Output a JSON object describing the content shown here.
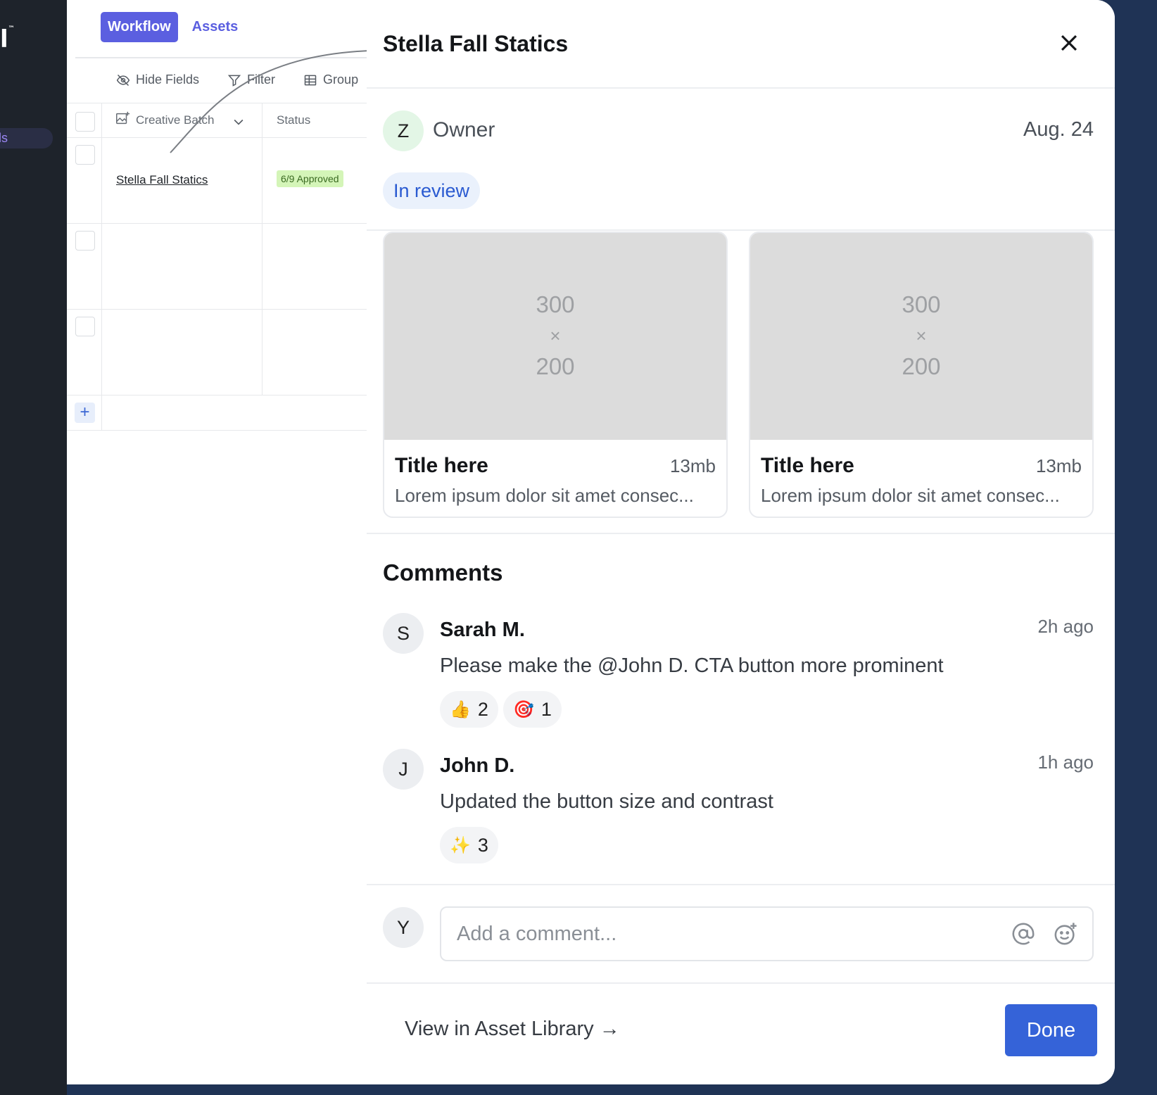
{
  "sidebar": {
    "logo_text": "l",
    "logo_mark": "™",
    "nav_item_label": "ls"
  },
  "tabs": [
    {
      "label": "Workflow",
      "active": true
    },
    {
      "label": "Assets",
      "active": false
    }
  ],
  "toolbar": {
    "hide_fields": "Hide Fields",
    "filter": "Filter",
    "group": "Group"
  },
  "table": {
    "columns": [
      "Creative Batch",
      "Status"
    ],
    "rows": [
      {
        "name": "Stella Fall Statics",
        "status": "6/9 Approved"
      },
      {
        "name": "",
        "status": ""
      },
      {
        "name": "",
        "status": ""
      }
    ],
    "add_label": "+"
  },
  "drawer": {
    "title": "Stella Fall Statics",
    "owner": {
      "initial": "Z",
      "label": "Owner",
      "date": "Aug. 24"
    },
    "status": "In review",
    "assets": [
      {
        "placeholder_w": "300",
        "placeholder_x": "×",
        "placeholder_h": "200",
        "title": "Title here",
        "size": "13mb",
        "desc": "Lorem ipsum dolor sit amet consec..."
      },
      {
        "placeholder_w": "300",
        "placeholder_x": "×",
        "placeholder_h": "200",
        "title": "Title here",
        "size": "13mb",
        "desc": "Lorem ipsum dolor sit amet consec..."
      }
    ],
    "comments_heading": "Comments",
    "comments": [
      {
        "initial": "S",
        "author": "Sarah M.",
        "time": "2h ago",
        "text": "Please make the @John D. CTA button more prominent",
        "reactions": [
          {
            "emoji": "👍",
            "count": "2"
          },
          {
            "emoji": "🎯",
            "count": "1"
          }
        ]
      },
      {
        "initial": "J",
        "author": "John D.",
        "time": "1h ago",
        "text": "Updated the button size and contrast",
        "reactions": [
          {
            "emoji": "✨",
            "count": "3"
          }
        ]
      }
    ],
    "composer": {
      "initial": "Y",
      "placeholder": "Add a comment..."
    },
    "footer": {
      "view_link": "View in Asset Library →",
      "done": "Done"
    }
  },
  "colors": {
    "background": "#1f3355",
    "accent": "#5b5fe0",
    "primary_button": "#3563d8",
    "status_pill_bg": "#eaf1fc",
    "approved_badge_bg": "#d4f5b8"
  }
}
